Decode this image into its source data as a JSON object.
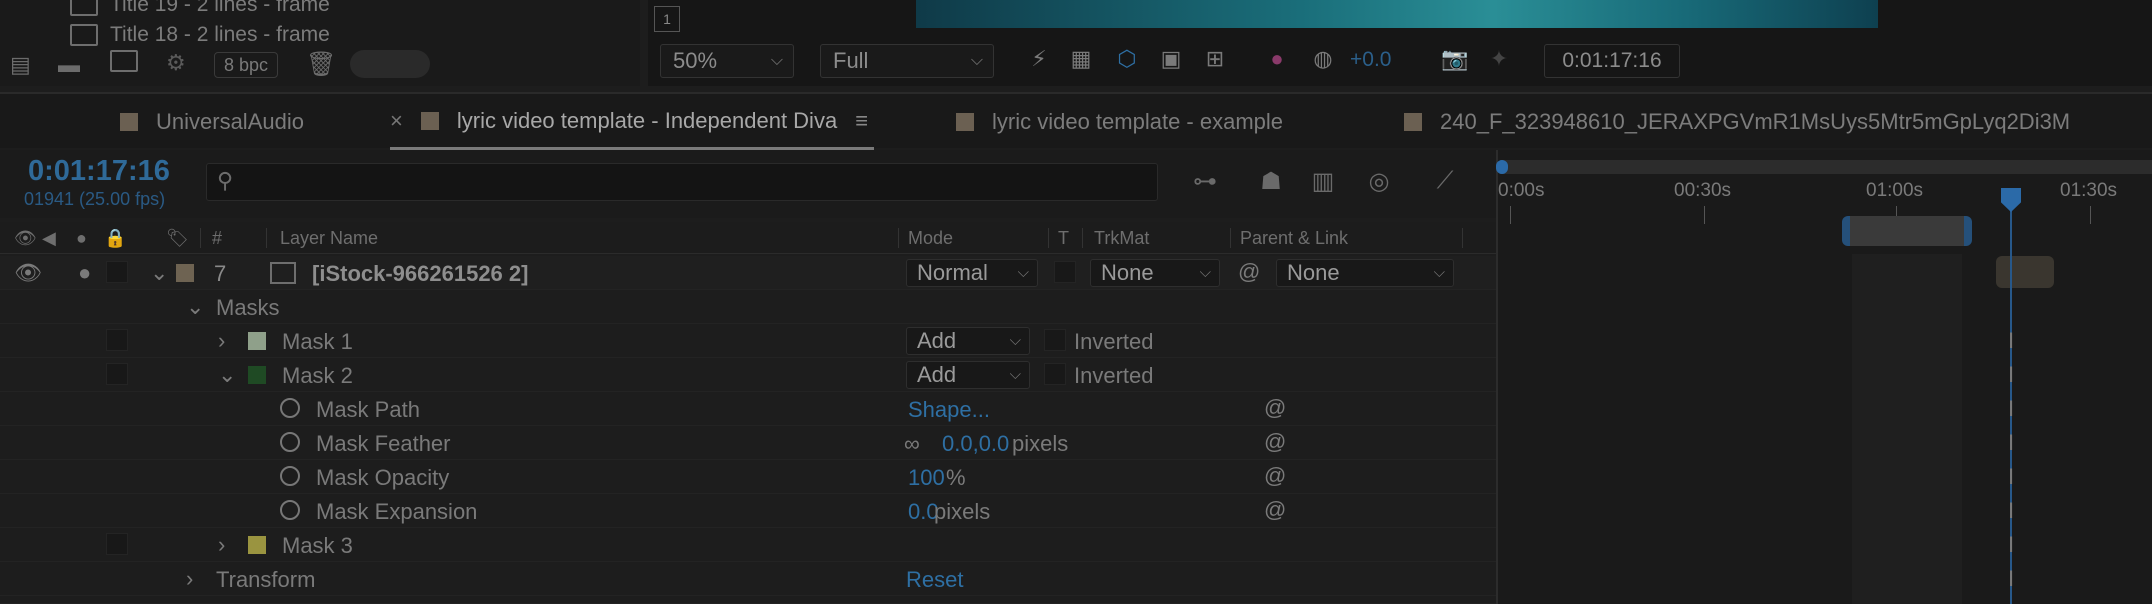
{
  "project_panel": {
    "rows": [
      {
        "label": "Title 19 - 2 lines - frame"
      },
      {
        "label": "Title 18 - 2 lines - frame"
      }
    ],
    "bpc_label": "8 bpc"
  },
  "viewer": {
    "zoom": "50%",
    "resolution": "Full",
    "exposure": "+0.0",
    "timecode": "0:01:17:16",
    "frame_marker": "1"
  },
  "tabs": [
    {
      "label": "UniversalAudio"
    },
    {
      "label": "lyric video template - Independent Diva",
      "active": true
    },
    {
      "label": "lyric video template - example"
    },
    {
      "label": "240_F_323948610_JERAXPGVmR1MsUys5Mtr5mGpLyq2Di3M"
    }
  ],
  "timeline": {
    "current_time": "0:01:17:16",
    "frame_info": "01941 (25.00 fps)",
    "search_placeholder": "",
    "ruler": [
      "0:00s",
      "00:30s",
      "01:00s",
      "01:30s"
    ]
  },
  "columns": {
    "number": "#",
    "layer_name": "Layer Name",
    "mode": "Mode",
    "t": "T",
    "trkmat": "TrkMat",
    "parent": "Parent & Link"
  },
  "layer": {
    "number": "7",
    "name": "[iStock-966261526 2]",
    "mode": "Normal",
    "trkmat": "None",
    "parent": "None"
  },
  "masks_group": "Masks",
  "masks": [
    {
      "name": "Mask 1",
      "mode": "Add",
      "inverted": "Inverted",
      "color": "#8fa08a"
    },
    {
      "name": "Mask 2",
      "mode": "Add",
      "inverted": "Inverted",
      "color": "#1f4a24"
    },
    {
      "name": "Mask 3",
      "color": "#9a9440"
    }
  ],
  "mask2_props": [
    {
      "name": "Mask Path",
      "value": "Shape...",
      "unit": ""
    },
    {
      "name": "Mask Feather",
      "value": "0.0,0.0",
      "unit": " pixels"
    },
    {
      "name": "Mask Opacity",
      "value": "100",
      "unit": "%"
    },
    {
      "name": "Mask Expansion",
      "value": "0.0",
      "unit": " pixels"
    }
  ],
  "transform": {
    "label": "Transform",
    "reset": "Reset"
  }
}
